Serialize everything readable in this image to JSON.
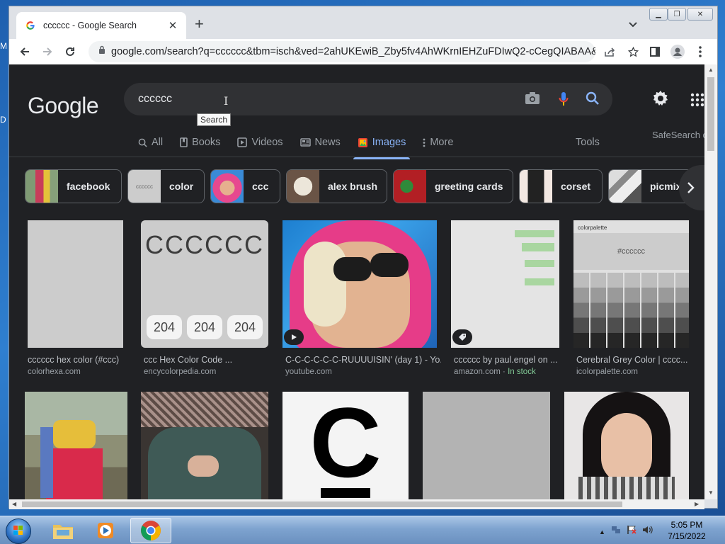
{
  "desktop": {
    "peek_top": "M",
    "peek_mid": "D"
  },
  "browser": {
    "tab_title": "cccccc - Google Search",
    "url": "google.com/search?q=cccccc&tbm=isch&ved=2ahUKEwiB_Zby5fv4AhWKrnIEHZuFDIwQ2-cCegQIABAA&o..."
  },
  "google": {
    "logo": "Google",
    "query": "cccccc",
    "tooltip": "Search",
    "nav": [
      {
        "label": "All",
        "icon": "search-icon"
      },
      {
        "label": "Books",
        "icon": "book-icon"
      },
      {
        "label": "Videos",
        "icon": "video-icon"
      },
      {
        "label": "News",
        "icon": "news-icon"
      },
      {
        "label": "Images",
        "icon": "image-icon",
        "active": true
      },
      {
        "label": "More",
        "icon": "more-dots-icon"
      }
    ],
    "tools": "Tools",
    "safesearch": "SafeSearch o",
    "chips": [
      "facebook",
      "color",
      "ccc",
      "alex brush",
      "greeting cards",
      "corset",
      "picmix"
    ]
  },
  "results_row1": [
    {
      "caption": "cccccc hex color (#ccc)",
      "source": "colorhexa.com"
    },
    {
      "caption": "ccc Hex Color Code ...",
      "source": "encycolorpedia.com",
      "big_text": "CCCCCC",
      "chips": [
        "204",
        "204",
        "204"
      ]
    },
    {
      "caption": "C-C-C-C-C-C-RUUUUISIN' (day 1) - Yo...",
      "source": "youtube.com"
    },
    {
      "caption": "cccccc by paul.engel on ...",
      "source": "amazon.com",
      "stock": "In stock"
    },
    {
      "caption": "Cerebral Grey Color | cccc...",
      "source": "icolorpalette.com",
      "inner_title": "#cccccc",
      "brand": "colorpalette"
    }
  ],
  "results_row2": [
    {
      "letter": "C"
    }
  ],
  "taskbar": {
    "time": "5:05 PM",
    "date": "7/15/2022"
  },
  "colors": {
    "page_bg": "#202124",
    "accent_blue": "#8ab4f8",
    "text_muted": "#9aa0a6",
    "swatch_gray": "#cccccc"
  }
}
